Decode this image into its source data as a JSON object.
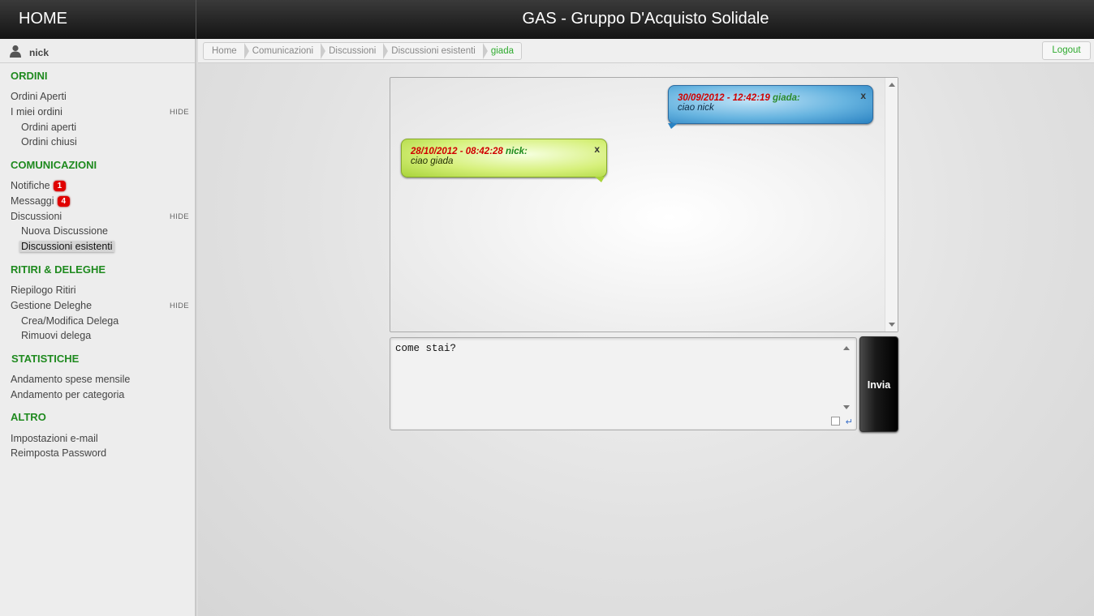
{
  "topbar": {
    "home_label": "HOME",
    "title": "GAS - Gruppo D'Acquisto Solidale"
  },
  "user": {
    "name": "nick"
  },
  "sidebar": {
    "ordini": {
      "title": "ORDINI",
      "items": [
        "Ordini Aperti",
        "I miei ordini"
      ],
      "hide": "HIDE",
      "sub": [
        "Ordini aperti",
        "Ordini chiusi"
      ]
    },
    "comunicazioni": {
      "title": "COMUNICAZIONI",
      "notifiche": "Notifiche",
      "notifiche_count": "1",
      "messaggi": "Messaggi",
      "messaggi_count": "4",
      "discussioni": "Discussioni",
      "hide": "HIDE",
      "sub": [
        "Nuova Discussione",
        "Discussioni esistenti"
      ]
    },
    "ritiri": {
      "title": "RITIRI & DELEGHE",
      "items": [
        "Riepilogo Ritiri",
        "Gestione Deleghe"
      ],
      "hide": "HIDE",
      "sub": [
        "Crea/Modifica Delega",
        "Rimuovi delega"
      ]
    },
    "statistiche": {
      "title": "STATISTICHE",
      "items": [
        "Andamento spese mensile",
        "Andamento per categoria"
      ]
    },
    "altro": {
      "title": "ALTRO",
      "items": [
        "Impostazioni e-mail",
        "Reimposta Password"
      ]
    }
  },
  "breadcrumb": [
    "Home",
    "Comunicazioni",
    "Discussioni",
    "Discussioni esistenti",
    "giada"
  ],
  "logout_label": "Logout",
  "messages": [
    {
      "date": "30/09/2012 - 12:42:19",
      "author": "giada:",
      "text": "ciao nick",
      "close": "x"
    },
    {
      "date": "28/10/2012 - 08:42:28",
      "author": "nick:",
      "text": "ciao giada",
      "close": "x"
    }
  ],
  "composer": {
    "value": "come stai?",
    "enter_symbol": "↵",
    "send_label": "Invia"
  },
  "colors": {
    "accent_green": "#1f8a1f",
    "badge_red": "#e00000",
    "date_red": "#d00000"
  }
}
